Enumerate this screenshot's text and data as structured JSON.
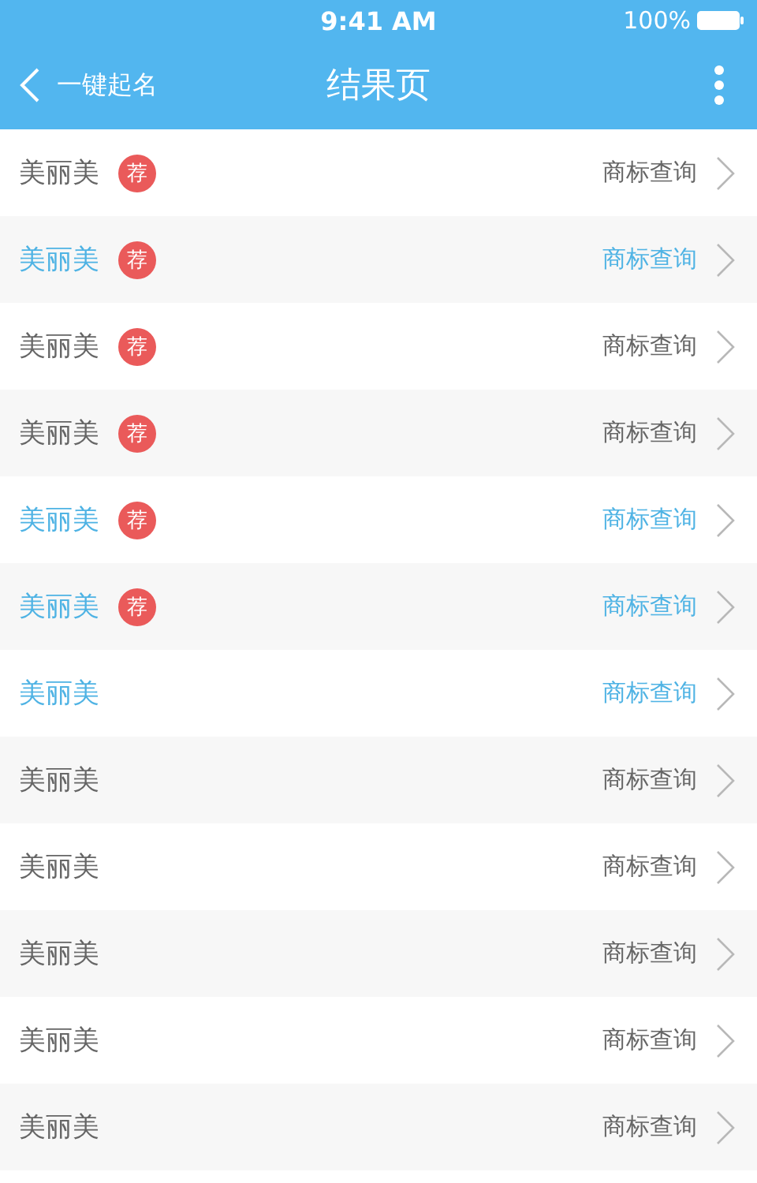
{
  "status_bar": {
    "time": "9:41 AM",
    "battery": "100%"
  },
  "header": {
    "back_label": "一键起名",
    "title": "结果页"
  },
  "results": [
    {
      "name": "美丽美",
      "badge": "荐",
      "highlighted": false,
      "action": "商标查询"
    },
    {
      "name": "美丽美",
      "badge": "荐",
      "highlighted": true,
      "action": "商标查询"
    },
    {
      "name": "美丽美",
      "badge": "荐",
      "highlighted": false,
      "action": "商标查询"
    },
    {
      "name": "美丽美",
      "badge": "荐",
      "highlighted": false,
      "action": "商标查询"
    },
    {
      "name": "美丽美",
      "badge": "荐",
      "highlighted": true,
      "action": "商标查询"
    },
    {
      "name": "美丽美",
      "badge": "荐",
      "highlighted": true,
      "action": "商标查询"
    },
    {
      "name": "美丽美",
      "highlighted": true,
      "action": "商标查询"
    },
    {
      "name": "美丽美",
      "highlighted": false,
      "action": "商标查询"
    },
    {
      "name": "美丽美",
      "highlighted": false,
      "action": "商标查询"
    },
    {
      "name": "美丽美",
      "highlighted": false,
      "action": "商标查询"
    },
    {
      "name": "美丽美",
      "highlighted": false,
      "action": "商标查询"
    },
    {
      "name": "美丽美",
      "highlighted": false,
      "action": "商标查询"
    }
  ]
}
